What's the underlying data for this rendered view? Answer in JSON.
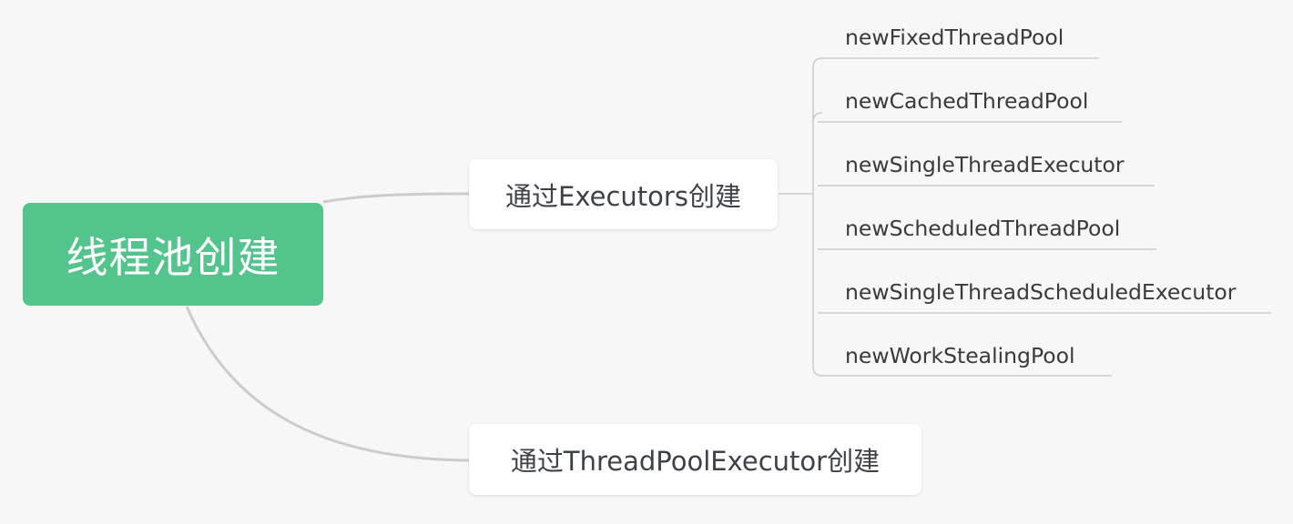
{
  "root": {
    "label": "线程池创建",
    "color": "#52c48c"
  },
  "branches": [
    {
      "label": "通过Executors创建",
      "children": [
        "newFixedThreadPool",
        "newCachedThreadPool",
        "newSingleThreadExecutor",
        "newScheduledThreadPool",
        "newSingleThreadScheduledExecutor",
        "newWorkStealingPool"
      ]
    },
    {
      "label": "通过ThreadPoolExecutor创建",
      "children": []
    }
  ]
}
